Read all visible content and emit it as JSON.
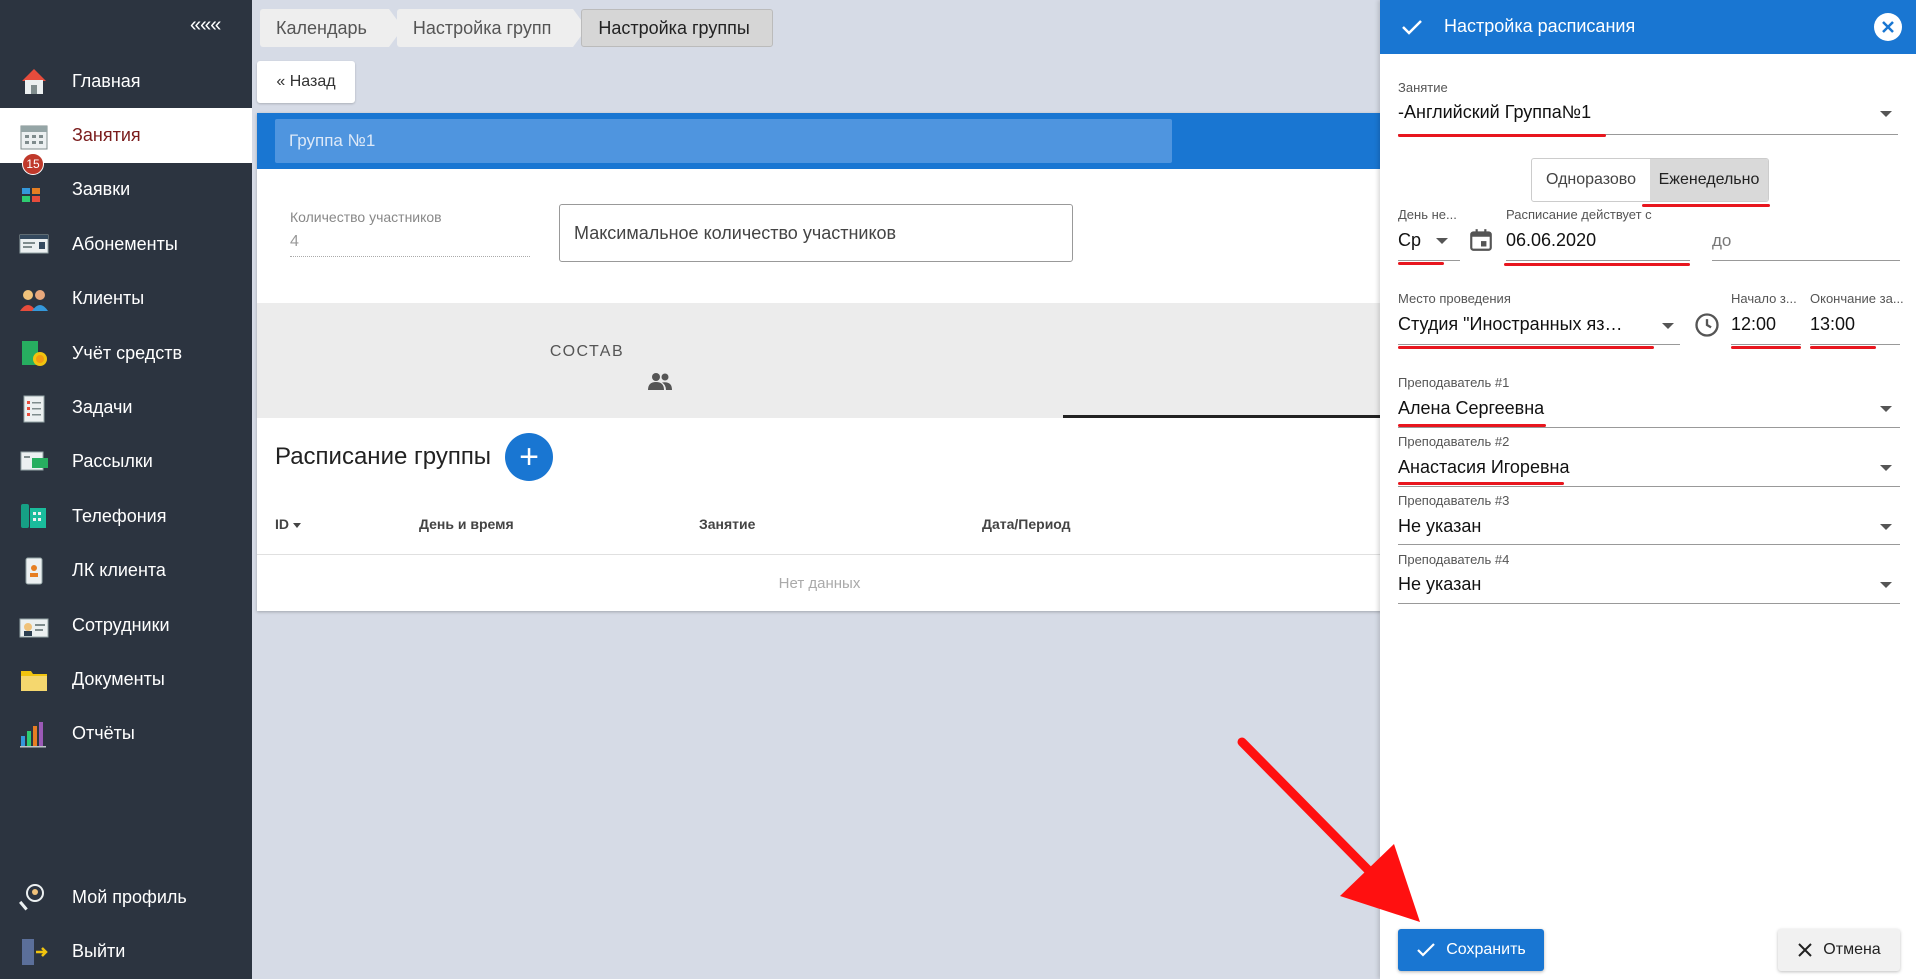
{
  "sidebar": {
    "collapse_label": "«««",
    "items": [
      {
        "label": "Главная",
        "icon": "home-icon"
      },
      {
        "label": "Занятия",
        "icon": "calendar-icon",
        "active": true
      },
      {
        "label": "Заявки",
        "icon": "requests-icon",
        "badge": "15"
      },
      {
        "label": "Абонементы",
        "icon": "card-icon"
      },
      {
        "label": "Клиенты",
        "icon": "clients-icon"
      },
      {
        "label": "Учёт средств",
        "icon": "money-icon"
      },
      {
        "label": "Задачи",
        "icon": "tasks-icon"
      },
      {
        "label": "Рассылки",
        "icon": "mailing-icon"
      },
      {
        "label": "Телефония",
        "icon": "phone-icon"
      },
      {
        "label": "ЛК клиента",
        "icon": "client-cabinet-icon"
      },
      {
        "label": "Сотрудники",
        "icon": "staff-icon"
      },
      {
        "label": "Документы",
        "icon": "documents-icon"
      },
      {
        "label": "Отчёты",
        "icon": "reports-icon"
      }
    ],
    "bottom": [
      {
        "label": "Мой профиль",
        "icon": "profile-icon"
      },
      {
        "label": "Выйти",
        "icon": "logout-icon"
      }
    ]
  },
  "breadcrumbs": [
    "Календарь",
    "Настройка групп",
    "Настройка группы"
  ],
  "main": {
    "back_label": "« Назад",
    "group_name": "Группа №1",
    "count_label": "Количество участников",
    "count_value": "4",
    "max_placeholder": "Максимальное количество участников",
    "tab_label": "СОСТАВ",
    "schedule_title": "Расписание группы",
    "add_label": "+",
    "columns": [
      "ID",
      "День и время",
      "Занятие",
      "Дата/Период"
    ],
    "empty_text": "Нет данных"
  },
  "panel": {
    "title": "Настройка расписания",
    "lesson_label": "Занятие",
    "lesson_value": "-Английский Группа№1",
    "mode_options": [
      "Одноразово",
      "Еженедельно"
    ],
    "mode_selected": "Еженедельно",
    "day_label": "День не...",
    "day_value": "Ср",
    "valid_from_label": "Расписание действует с",
    "valid_from_value": "06.06.2020",
    "valid_to_label": "до",
    "place_label": "Место проведения",
    "place_value": "Студия \"Иностранных язы...",
    "start_label": "Начало з...",
    "start_value": "12:00",
    "end_label": "Окончание за...",
    "end_value": "13:00",
    "teachers": [
      {
        "label": "Преподаватель #1",
        "value": "Алена Сергеевна"
      },
      {
        "label": "Преподаватель #2",
        "value": "Анастасия Игоревна"
      },
      {
        "label": "Преподаватель #3",
        "value": "Не указан"
      },
      {
        "label": "Преподаватель #4",
        "value": "Не указан"
      }
    ],
    "save_label": "Сохранить",
    "cancel_label": "Отмена"
  },
  "colors": {
    "primary": "#1976d2",
    "sidebar": "#2c3440",
    "annotation": "#e8161e"
  }
}
